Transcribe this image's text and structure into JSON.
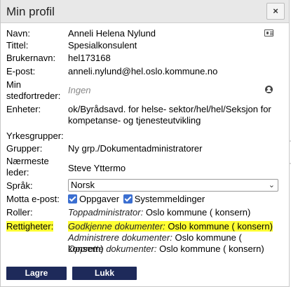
{
  "dialog": {
    "title": "Min profil",
    "close_label": "×"
  },
  "fields": {
    "navn_label": "Navn:",
    "navn_value": "Anneli Helena Nylund",
    "tittel_label": "Tittel:",
    "tittel_value": "Spesialkonsulent",
    "brukernavn_label": "Brukernavn:",
    "brukernavn_value": "hel173168",
    "epost_label": "E-post:",
    "epost_value": "anneli.nylund@hel.oslo.kommune.no",
    "stedfortreder_label_1": "Min",
    "stedfortreder_label_2": "stedfortreder:",
    "stedfortreder_value": "Ingen",
    "enheter_label": "Enheter:",
    "enheter_value_1": "ok/Byrådsavd. for helse- sektor/hel/hel/Seksjon for",
    "enheter_value_2": "kompetanse- og tjenesteutvikling",
    "yrkesgrupper_label": "Yrkesgrupper:",
    "grupper_label": "Grupper:",
    "grupper_value": "Ny grp./Dokumentadministratorer",
    "leder_label_1": "Nærmeste",
    "leder_label_2": "leder:",
    "leder_value": "Steve Yttermo",
    "sprak_label": "Språk:",
    "sprak_value": "Norsk",
    "motta_label": "Motta e-post:",
    "motta_opt1": "Oppgaver",
    "motta_opt2": "Systemmeldinger",
    "roller_label": "Roller:",
    "roller_role": "Toppadministrator:",
    "roller_org": "Oslo kommune ( konsern)",
    "rettigheter_label": "Rettigheter:",
    "rett1_role": "Godkjenne dokumenter:",
    "rett1_org": "Oslo kommune ( konsern)",
    "rett2_role": "Administrere dokumenter:",
    "rett2_org": "Oslo kommune ( konsern)",
    "rett3_role": "Opprette dokumenter:",
    "rett3_org": "Oslo kommune ( konsern)"
  },
  "buttons": {
    "save": "Lagre",
    "close": "Lukk"
  },
  "colors": {
    "button_bg": "#1e2a5a",
    "checkbox": "#3b6fd1",
    "highlight": "#ffff33"
  }
}
